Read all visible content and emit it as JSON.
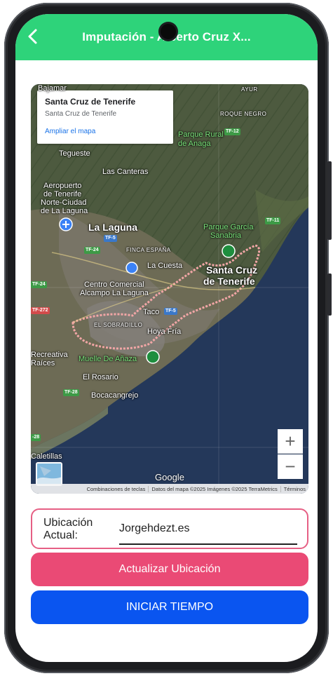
{
  "app_bar": {
    "title": "Imputación - Alberto Cruz X...",
    "color": "#2ed37a"
  },
  "map": {
    "info_card": {
      "title": "Santa Cruz de Tenerife",
      "subtitle": "Santa Cruz de Tenerife",
      "link": "Ampliar el mapa"
    },
    "labels": {
      "bajamar": "Bajamar",
      "tegueste": "Tegueste",
      "las_canteras": "Las Canteras",
      "aeropuerto_1": "Aeropuerto",
      "aeropuerto_2": "de Tenerife",
      "aeropuerto_3": "Norte-Ciudad",
      "aeropuerto_4": "de La Laguna",
      "la_laguna": "La Laguna",
      "finca_espana": "FINCA ESPAÑA",
      "la_cuesta": "La Cuesta",
      "parque_1": "Parque García",
      "parque_2": "Sanabria",
      "santa_cruz_1": "Santa Cruz",
      "santa_cruz_2": "de Tenerife",
      "centro_1": "Centro Comercial",
      "centro_2": "Alcampo La Laguna",
      "taco": "Taco",
      "el_sobradillo": "EL SOBRADILLO",
      "hoya_fria": "Hoya Fría",
      "recreativa_1": "Recreativa",
      "recreativa_2": "Raíces",
      "muelle": "Muelle De Añaza",
      "el_rosario": "El Rosario",
      "bocacangrejo": "Bocacangrejo",
      "roque_negro": "ROQUE NEGRO",
      "parque_rural_1": "Parque Rural",
      "parque_rural_2": "de Anaga",
      "ayur": "AYUR",
      "las_caletillas": "Caletillas"
    },
    "roads": {
      "tf5": "TF-5",
      "tf5b": "TF-5",
      "tf24": "TF-24",
      "tf24b": "TF-24",
      "tf272": "TF-272",
      "tf28": "TF-28",
      "tf11": "TF-11",
      "tf12": "TF-12",
      "tf28b": "-28"
    },
    "zoom_in": "+",
    "zoom_out": "−",
    "google": "Google",
    "attribution": {
      "shortcuts": "Combinaciones de teclas",
      "data": "Datos del mapa ©2025 Imágenes ©2025 TerraMetrics",
      "terms": "Términos"
    }
  },
  "location": {
    "label": "Ubicación Actual:",
    "value": "Jorgehdezt.es"
  },
  "buttons": {
    "update": "Actualizar Ubicación",
    "start": "INICIAR TIEMPO"
  }
}
